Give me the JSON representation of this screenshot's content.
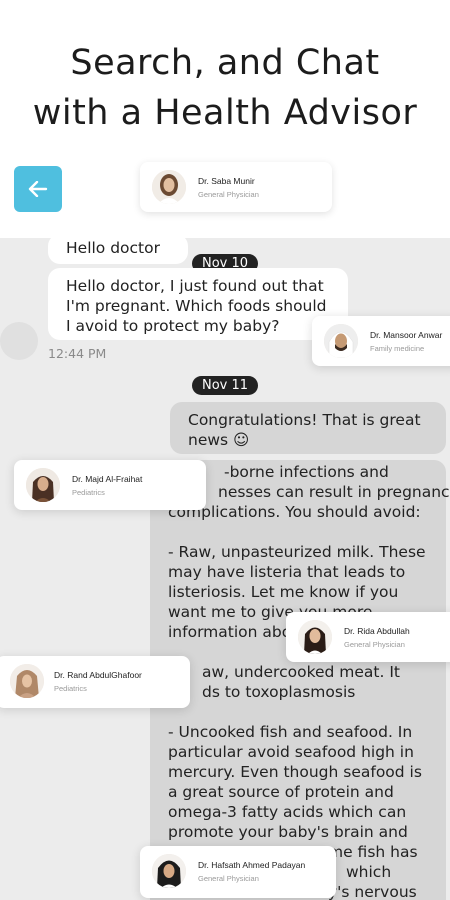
{
  "headline": {
    "line1": "Search, and Chat",
    "line2": "with a Health Advisor"
  },
  "top_card": {
    "name": "Dr. Saba Munir",
    "role": "General Physician"
  },
  "chat": {
    "first_message": "Hello doctor",
    "date1": "Nov 10",
    "question_lines": [
      "Hello doctor, I just found out that",
      "I'm pregnant. Which foods should",
      "I avoid to protect my baby?"
    ],
    "question_time": "12:44 PM",
    "date2": "Nov 11",
    "reply_lines": [
      "Congratulations! That is great",
      "news ☺"
    ],
    "advice_lines": [
      "-borne infections and",
      "nesses can result in pregnancy",
      "complications. You should avoid:",
      "",
      "- Raw, unpasteurized milk. These",
      "may have listeria that leads to",
      "listeriosis. Let me know if you",
      "want me to give you more",
      "information abo",
      "",
      "aw, undercooked meat. It",
      "ds to toxoplasmosis",
      "",
      "- Uncooked fish and seafood. In",
      "particular avoid seafood high in",
      "mercury. Even though seafood is",
      "a great source of protein and",
      "omega-3 fatty acids which can",
      "promote your baby's brain and",
      "me fish has",
      "which",
      "y's nervous"
    ]
  },
  "doctors": [
    {
      "name": "Dr. Mansoor Anwar",
      "role": "Family medicine"
    },
    {
      "name": "Dr. Majd  Al-Fraihat",
      "role": "Pediatrics"
    },
    {
      "name": "Dr. Rida Abdullah",
      "role": "General Physician"
    },
    {
      "name": "Dr. Rand AbdulGhafoor",
      "role": "Pediatrics"
    },
    {
      "name": "Dr. Hafsath  Ahmed Padayan",
      "role": "General Physician"
    }
  ],
  "colors": {
    "accent": "#4fbfdf",
    "chat_bg": "#ececec",
    "sent_bubble": "#d6d6d6"
  }
}
